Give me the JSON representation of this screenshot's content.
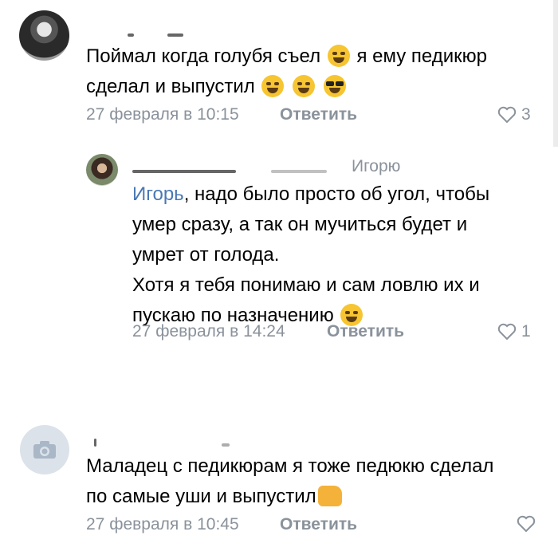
{
  "comments": [
    {
      "text": "Поймал когда голубя съел",
      "text2": "я ему педикюр",
      "text_line2": "сделал и выпустил",
      "date": "27 февраля в 10:15",
      "reply": "Ответить",
      "likes": "3"
    },
    {
      "reply_to": "Игорю",
      "mention": "Игорь",
      "line1": ", надо было просто об угол, чтобы",
      "line2": "умер сразу, а так он мучиться будет и",
      "line3": "умрет от голода.",
      "line4": "Хотя я тебя понимаю и сам ловлю их и",
      "line5": "пускаю по назначению",
      "date": "27 февраля в 14:24",
      "reply": "Ответить",
      "likes": "1"
    },
    {
      "line1": "Маладец с педикюрам я тоже педюкю сделал",
      "line2": "по самые уши и выпустил",
      "date": "27 февраля в 10:45",
      "reply": "Ответить"
    }
  ],
  "icons": {
    "like": "heart-outline-icon",
    "camera": "camera-icon"
  },
  "colors": {
    "link": "#4a78b5",
    "meta": "#8a929b",
    "emoji": "#f6c531"
  }
}
